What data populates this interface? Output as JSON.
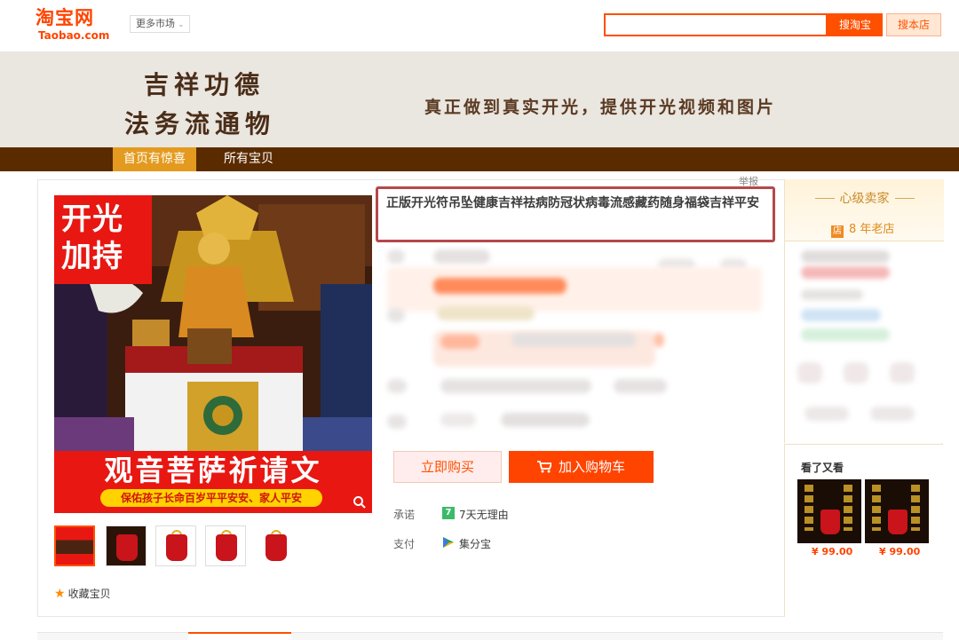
{
  "topbar": {
    "logo_cn": "淘宝网",
    "logo_en": "Taobao.com",
    "more_market": "更多市场",
    "search_placeholder": "",
    "search_taobao": "搜淘宝",
    "search_shop": "搜本店"
  },
  "banner": {
    "line1": "吉祥功德",
    "line2": "法务流通物",
    "slogan": "真正做到真实开光，提供开光视频和图片"
  },
  "shop_nav": {
    "home": "首页有惊喜",
    "all_items": "所有宝贝"
  },
  "product": {
    "report": "举报",
    "title": "正版开光符吊坠健康吉祥祛病防冠状病毒流感藏药随身福袋吉祥平安",
    "image_badge": "开光\n加持",
    "image_title": "观音菩萨祈请文",
    "image_subtitle": "保佑孩子长命百岁平平安安、家人平安",
    "buy_now": "立即购买",
    "add_to_cart": "加入购物车",
    "promise_label": "承诺",
    "promise_value": "7天无理由",
    "promise_icon_text": "7",
    "pay_label": "支付",
    "pay_value": "集分宝",
    "favorite": "收藏宝贝"
  },
  "seller": {
    "level": "心级卖家",
    "shop_icon_text": "店",
    "age": "8 年老店"
  },
  "also_viewed": {
    "title": "看了又看",
    "items": [
      {
        "price": "¥ 99.00"
      },
      {
        "price": "¥ 99.00"
      }
    ]
  },
  "colors": {
    "brand": "#ff5000",
    "nav_bg": "#5b2b00",
    "nav_active": "#e39a1e",
    "title_border": "#b6484b"
  }
}
